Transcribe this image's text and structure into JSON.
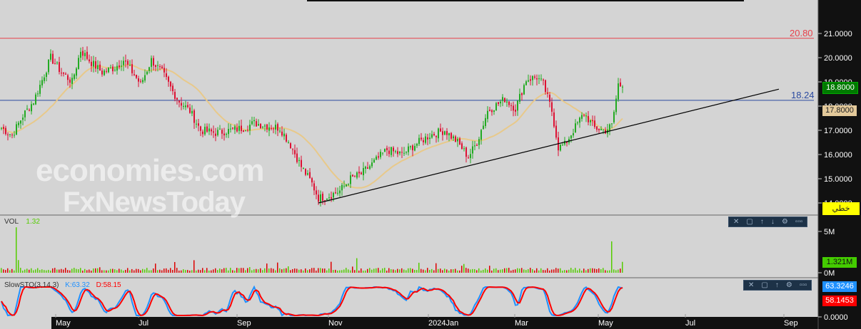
{
  "chart_data": {
    "type": "candlestick",
    "xlabels": [
      "May",
      "Jul",
      "Sep",
      "Nov",
      "2024Jan",
      "Mar",
      "May",
      "Jul",
      "Sep"
    ],
    "ylim": [
      13.6,
      21.5
    ],
    "yticks": [
      "21.0000",
      "20.0000",
      "19.0000",
      "18.0000",
      "17.0000",
      "16.0000",
      "15.0000",
      "14.0000"
    ],
    "price_points": [
      {
        "d": 0,
        "c": 17.1
      },
      {
        "d": 5,
        "c": 16.8
      },
      {
        "d": 10,
        "c": 17.6
      },
      {
        "d": 15,
        "c": 18.2
      },
      {
        "d": 20,
        "c": 19.3
      },
      {
        "d": 23,
        "c": 20.0
      },
      {
        "d": 28,
        "c": 19.4
      },
      {
        "d": 33,
        "c": 19.0
      },
      {
        "d": 37,
        "c": 20.3
      },
      {
        "d": 42,
        "c": 19.8
      },
      {
        "d": 47,
        "c": 19.4
      },
      {
        "d": 53,
        "c": 19.6
      },
      {
        "d": 57,
        "c": 19.9
      },
      {
        "d": 62,
        "c": 19.3
      },
      {
        "d": 65,
        "c": 18.9
      },
      {
        "d": 70,
        "c": 19.9
      },
      {
        "d": 75,
        "c": 19.4
      },
      {
        "d": 80,
        "c": 18.6
      },
      {
        "d": 83,
        "c": 18.2
      },
      {
        "d": 88,
        "c": 17.8
      },
      {
        "d": 93,
        "c": 17.0
      },
      {
        "d": 100,
        "c": 16.9
      },
      {
        "d": 107,
        "c": 17.0
      },
      {
        "d": 113,
        "c": 17.1
      },
      {
        "d": 118,
        "c": 17.3
      },
      {
        "d": 123,
        "c": 17.2
      },
      {
        "d": 130,
        "c": 17.1
      },
      {
        "d": 135,
        "c": 16.4
      },
      {
        "d": 140,
        "c": 15.5
      },
      {
        "d": 145,
        "c": 14.8
      },
      {
        "d": 148,
        "c": 14.2
      },
      {
        "d": 153,
        "c": 14.3
      },
      {
        "d": 158,
        "c": 14.5
      },
      {
        "d": 163,
        "c": 15.0
      },
      {
        "d": 168,
        "c": 15.2
      },
      {
        "d": 173,
        "c": 15.6
      },
      {
        "d": 180,
        "c": 16.2
      },
      {
        "d": 187,
        "c": 16.0
      },
      {
        "d": 193,
        "c": 16.4
      },
      {
        "d": 200,
        "c": 16.8
      },
      {
        "d": 207,
        "c": 17.0
      },
      {
        "d": 213,
        "c": 16.5
      },
      {
        "d": 218,
        "c": 15.9
      },
      {
        "d": 222,
        "c": 16.5
      },
      {
        "d": 227,
        "c": 17.8
      },
      {
        "d": 232,
        "c": 18.1
      },
      {
        "d": 235,
        "c": 18.3
      },
      {
        "d": 240,
        "c": 17.9
      },
      {
        "d": 245,
        "c": 19.1
      },
      {
        "d": 250,
        "c": 19.2
      },
      {
        "d": 253,
        "c": 18.9
      },
      {
        "d": 257,
        "c": 17.8
      },
      {
        "d": 260,
        "c": 16.3
      },
      {
        "d": 263,
        "c": 16.4
      },
      {
        "d": 267,
        "c": 17.0
      },
      {
        "d": 272,
        "c": 17.7
      },
      {
        "d": 277,
        "c": 17.1
      },
      {
        "d": 282,
        "c": 17.0
      },
      {
        "d": 285,
        "c": 17.2
      },
      {
        "d": 287,
        "c": 18.3
      },
      {
        "d": 288,
        "c": 18.9
      },
      {
        "d": 290,
        "c": 18.8
      }
    ],
    "moving_average": {
      "color": "#e8c98a"
    },
    "hlines": [
      {
        "value": 20.8,
        "label": "20.80",
        "color": "#e8404a"
      },
      {
        "value": 18.24,
        "label": "18.24",
        "color": "#2a4aa0"
      }
    ],
    "trendline": {
      "from": {
        "d": 148,
        "c": 14.0
      },
      "to": {
        "d": 363,
        "c": 18.7
      }
    },
    "last_price": "18.8000",
    "ma_value": "17.8000",
    "type_badge": "خطي",
    "volume": {
      "label": "VOL",
      "value": "1.32",
      "last": "1.321M",
      "ticks": [
        "5M",
        "0M"
      ],
      "up_color": "#55cc00",
      "down_color": "#dd0000"
    },
    "stochastic": {
      "label": "SlowSTO(3,14,3)",
      "k_label": "K:63.32",
      "d_label": "D:58.15",
      "k_value": "63.3246",
      "d_value": "58.1453",
      "zero": "0.0000",
      "k_color": "#1e90ff",
      "d_color": "#ff0000"
    }
  },
  "watermark": {
    "line1": "economies.com",
    "line2": "FxNewsToday"
  }
}
